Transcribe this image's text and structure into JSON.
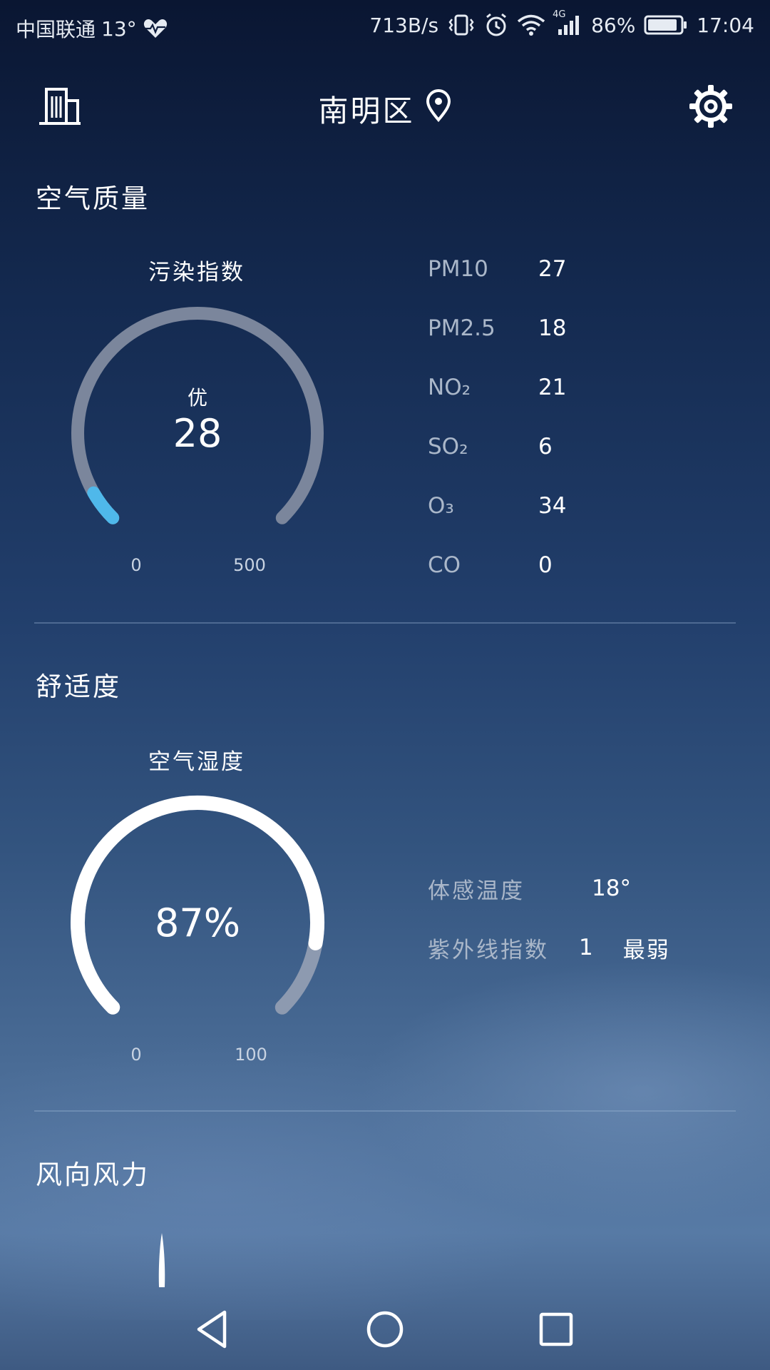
{
  "status_bar": {
    "carrier": "中国联通",
    "temperature": "13°",
    "net_speed": "713B/s",
    "network_type": "4G",
    "battery": "86%",
    "time": "17:04"
  },
  "header": {
    "location": "南明区"
  },
  "air_quality": {
    "section_title": "空气质量",
    "gauge_label": "污染指数",
    "grade": "优",
    "index_value": "28",
    "index_numeric": 28,
    "min_label": "0",
    "max_label": "500",
    "max_numeric": 500,
    "pollutants": [
      {
        "name": "PM10",
        "value": "27"
      },
      {
        "name": "PM2.5",
        "value": "18"
      },
      {
        "name": "NO₂",
        "value": "21"
      },
      {
        "name": "SO₂",
        "value": "6"
      },
      {
        "name": "O₃",
        "value": "34"
      },
      {
        "name": "CO",
        "value": "0"
      }
    ]
  },
  "comfort": {
    "section_title": "舒适度",
    "gauge_label": "空气湿度",
    "humidity_value": "87%",
    "humidity_numeric": 87,
    "min_label": "0",
    "max_label": "100",
    "max_numeric": 100,
    "feels_like_label": "体感温度",
    "feels_like_value": "18°",
    "uv_label": "紫外线指数",
    "uv_value": "1",
    "uv_level": "最弱"
  },
  "wind": {
    "section_title": "风向风力"
  },
  "colors": {
    "gauge_track": "#7b869c",
    "aqi_accent": "#4fb8ea",
    "humidity_fill": "#ffffff",
    "humidity_track": "#8d9ab0"
  }
}
